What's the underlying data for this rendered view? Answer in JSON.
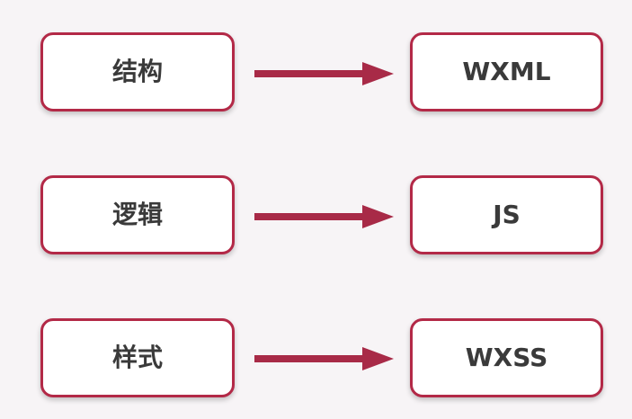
{
  "diagram": {
    "rows": [
      {
        "left": "结构",
        "right": "WXML"
      },
      {
        "left": "逻辑",
        "right": "JS"
      },
      {
        "left": "样式",
        "right": "WXSS"
      }
    ],
    "colors": {
      "border": "#b32947",
      "arrow": "#a82a47",
      "text": "#3a3a3a",
      "background": "#f7f4f6"
    },
    "icons": [
      "arrow-right-icon"
    ]
  }
}
